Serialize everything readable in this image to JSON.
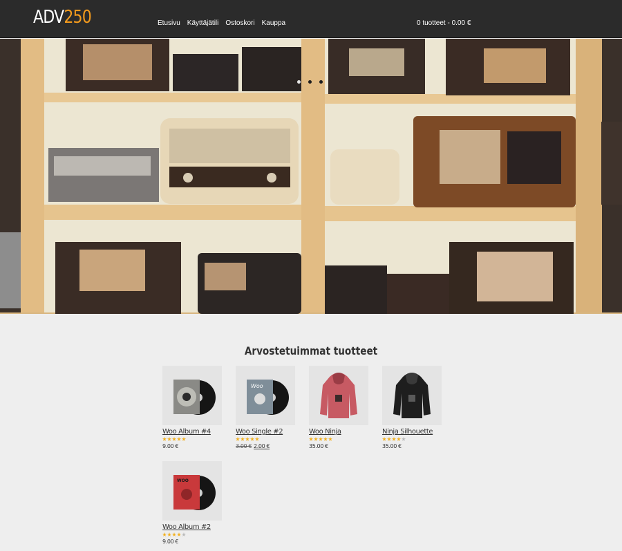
{
  "logo": {
    "part1": "ADV",
    "part2": "250"
  },
  "nav": {
    "items": [
      {
        "label": "Etusivu"
      },
      {
        "label": "Käyttäjätili"
      },
      {
        "label": "Ostoskori"
      },
      {
        "label": "Kauppa"
      }
    ]
  },
  "cart": {
    "label": "0 tuotteet - 0.00 €"
  },
  "slider": {
    "slide_count": 3,
    "active_index": 0
  },
  "section": {
    "title": "Arvostetuimmat tuotteet"
  },
  "products": [
    {
      "name": "Woo Album #4",
      "rating": 5,
      "price": "9.00 €"
    },
    {
      "name": "Woo Single #2",
      "rating": 5,
      "old_price": "3.00 €",
      "price": "2.00 €"
    },
    {
      "name": "Woo Ninja",
      "rating": 5,
      "price": "35.00 €"
    },
    {
      "name": "Ninja Silhouette",
      "rating": 4,
      "price": "35.00 €"
    },
    {
      "name": "Woo Album #2",
      "rating": 4,
      "price": "9.00 €"
    }
  ],
  "colors": {
    "accent": "#f29a1d",
    "header_bg": "#2b2b2b",
    "page_bg": "#eeeeee",
    "star": "#f2b01e"
  }
}
